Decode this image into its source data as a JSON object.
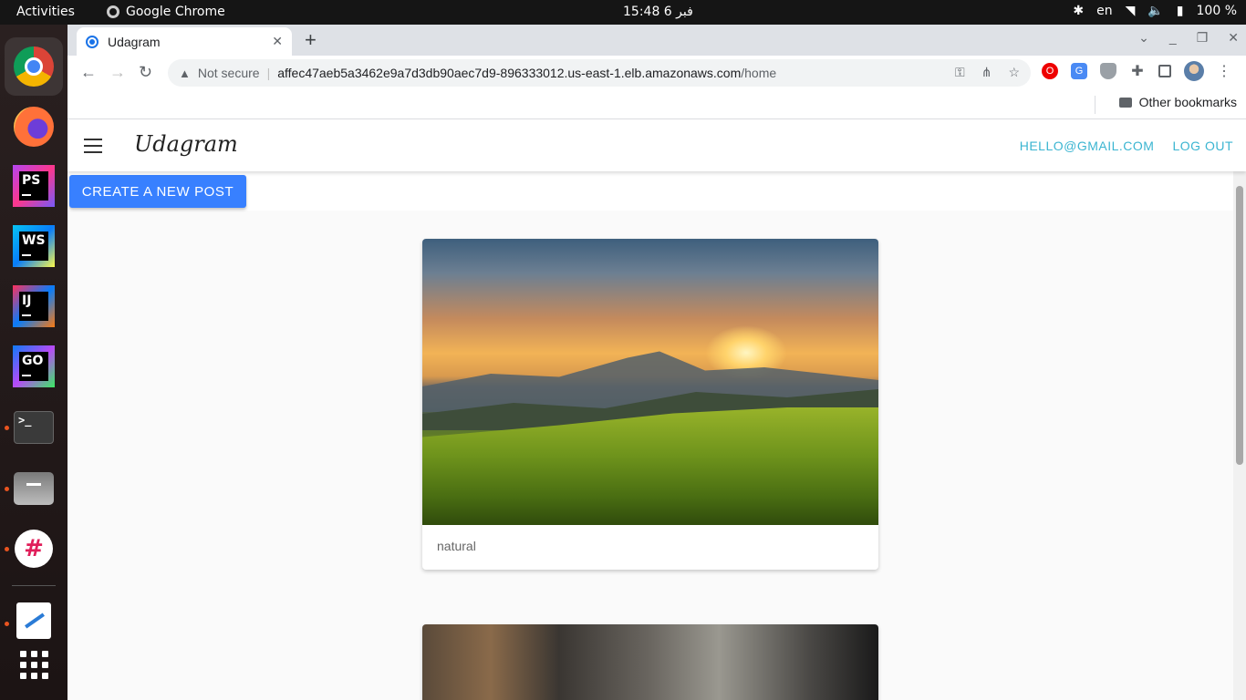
{
  "system": {
    "activities": "Activities",
    "app_name": "Google Chrome",
    "clock": "15:48  6 فبر",
    "lang": "en",
    "battery": "100 %"
  },
  "dock": {
    "apps": [
      "chrome",
      "firefox",
      "phpstorm",
      "webstorm",
      "intellij",
      "goland",
      "terminal",
      "files",
      "slack",
      "text-editor",
      "show-apps"
    ],
    "labels": {
      "ps": "PS",
      "ws": "WS",
      "ij": "IJ",
      "go": "GO",
      "term": ">_"
    }
  },
  "browser": {
    "tab_title": "Udagram",
    "not_secure": "Not secure",
    "url_host": "affec47aeb5a3462e9a7d3db90aec7d9-896333012.us-east-1.elb.amazonaws.com",
    "url_path": "/home",
    "other_bookmarks": "Other bookmarks"
  },
  "app": {
    "brand": "Udagram",
    "user_email": "HELLO@GMAIL.COM",
    "logout": "LOG OUT",
    "create_post": "CREATE A NEW POST",
    "posts": [
      {
        "caption": "natural"
      }
    ]
  },
  "colors": {
    "accent": "#3880ff",
    "nav_link": "#3bb5d1"
  }
}
